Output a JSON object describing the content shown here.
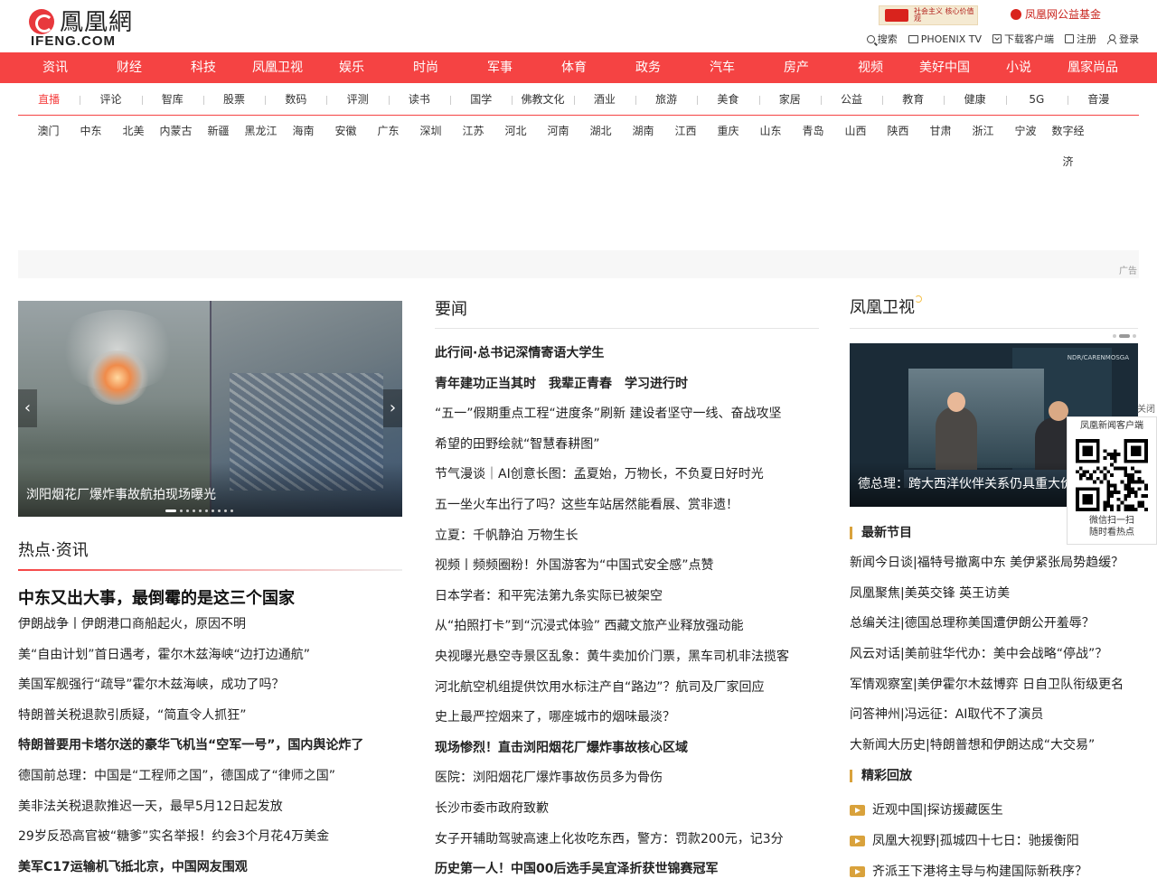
{
  "logo": {
    "cn": "鳳凰網",
    "en": "IFENG.COM"
  },
  "banners": {
    "b1": "社会主义 核心价值观",
    "b2": "凤凰网公益基金"
  },
  "tools": [
    {
      "icon": "search-icon",
      "label": "搜索"
    },
    {
      "icon": "tv-icon",
      "label": "PHOENIX TV"
    },
    {
      "icon": "download-icon",
      "label": "下载客户端"
    },
    {
      "icon": "register-icon",
      "label": "注册"
    },
    {
      "icon": "user-icon",
      "label": "登录"
    }
  ],
  "nav_primary": [
    "资讯",
    "财经",
    "科技",
    "凤凰卫视",
    "娱乐",
    "时尚",
    "军事",
    "体育",
    "政务",
    "汽车",
    "房产",
    "视频",
    "美好中国",
    "小说",
    "凰家尚品"
  ],
  "nav_secondary": [
    "直播",
    "评论",
    "智库",
    "股票",
    "数码",
    "评测",
    "读书",
    "国学",
    "佛教文化",
    "酒业",
    "旅游",
    "美食",
    "家居",
    "公益",
    "教育",
    "健康",
    "5G",
    "音漫"
  ],
  "nav_regions": [
    "澳门",
    "中东",
    "北美",
    "内蒙古",
    "新疆",
    "黑龙江",
    "海南",
    "安徽",
    "广东",
    "深圳",
    "江苏",
    "河北",
    "河南",
    "湖北",
    "湖南",
    "江西",
    "重庆",
    "山东",
    "青岛",
    "山西",
    "陕西",
    "甘肃",
    "浙江",
    "宁波",
    "数字经济"
  ],
  "ad_label": "广告",
  "slider": {
    "caption": "浏阳烟花厂爆炸事故航拍现场曝光",
    "prev": "‹",
    "next": "›"
  },
  "hot": {
    "title": "热点·资讯",
    "headline": "中东又出大事，最倒霉的是这三个国家",
    "items": [
      {
        "text": "伊朗战争丨伊朗港口商船起火，原因不明",
        "bold": false
      },
      {
        "text": "美“自由计划”首日遇考，霍尔木兹海峡“边打边通航”",
        "bold": false
      },
      {
        "text": "美国军舰强行“疏导”霍尔木兹海峡，成功了吗？",
        "bold": false
      },
      {
        "text": "特朗普关税退款引质疑，“简直令人抓狂”",
        "bold": false
      },
      {
        "text": "特朗普要用卡塔尔送的豪华飞机当“空军一号”，国内舆论炸了",
        "bold": true
      },
      {
        "text": "德国前总理：中国是“工程师之国”，德国成了“律师之国”",
        "bold": false
      },
      {
        "text": "美非法关税退款推迟一天，最早5月12日起发放",
        "bold": false
      },
      {
        "text": "29岁反恐高官被“糖爹”实名举报！约会3个月花4万美金",
        "bold": false
      },
      {
        "text": "美军C17运输机飞抵北京，中国网友围观",
        "bold": true
      }
    ]
  },
  "news": {
    "title": "要闻",
    "items": [
      {
        "text": "此行间·总书记深情寄语大学生",
        "bold": true
      },
      {
        "text": "青年建功正当其时　我辈正青春　学习进行时",
        "bold": true
      },
      {
        "text": "“五一”假期重点工程“进度条”刷新 建设者坚守一线、奋战攻坚",
        "bold": false
      },
      {
        "text": "希望的田野绘就“智慧春耕图”",
        "bold": false
      },
      {
        "text": "节气漫谈｜AI创意长图：孟夏始，万物长，不负夏日好时光",
        "bold": false
      },
      {
        "text": "五一坐火车出行了吗？这些车站居然能看展、赏非遗！",
        "bold": false
      },
      {
        "text": "立夏：千帆静泊 万物生长",
        "bold": false
      },
      {
        "text": "视频丨频频圈粉！外国游客为“中国式安全感”点赞",
        "bold": false
      },
      {
        "text": "日本学者：和平宪法第九条实际已被架空",
        "bold": false
      },
      {
        "text": "从“拍照打卡”到“沉浸式体验” 西藏文旅产业释放强动能",
        "bold": false
      },
      {
        "text": "央视曝光悬空寺景区乱象：黄牛卖加价门票，黑车司机非法揽客",
        "bold": false
      },
      {
        "text": "河北航空机组提供饮用水标注产自“路边”？航司及厂家回应",
        "bold": false
      },
      {
        "text": "史上最严控烟来了，哪座城市的烟味最淡？",
        "bold": false
      },
      {
        "text": "现场惨烈！直击浏阳烟花厂爆炸事故核心区域",
        "bold": true
      },
      {
        "text": "医院：浏阳烟花厂爆炸事故伤员多为骨伤",
        "bold": false
      },
      {
        "text": "长沙市委市政府致歉",
        "bold": false
      },
      {
        "text": "女子开辅助驾驶高速上化妆吃东西，警方：罚款200元，记3分",
        "bold": false
      },
      {
        "text": "历史第一人！中国00后选手吴宜泽折获世锦赛冠军",
        "bold": true
      }
    ]
  },
  "tv": {
    "title": "凤凰卫视",
    "image_caption": "德总理：跨大西洋伙伴关系仍具重大价值",
    "image_logo": "NDR/CARENMOSGA",
    "latest_title": "最新节目",
    "latest": [
      "新闻今日谈|福特号撤离中东 美伊紧张局势趋缓？",
      "凤凰聚焦|美英交锋 英王访美",
      "总编关注|德国总理称美国遭伊朗公开羞辱？",
      "风云对话|美前驻华代办：美中会战略“停战”？",
      "军情观察室|美伊霍尔木兹博弈 日自卫队衔级更名",
      "问答神州|冯远征：AI取代不了演员",
      "大新闻大历史|特朗普想和伊朗达成“大交易”"
    ],
    "replay_title": "精彩回放",
    "replay": [
      "近观中国|探访援藏医生",
      "凤凰大视野|孤城四十七日：驰援衡阳",
      "齐派王下港将主导与构建国际新秩序？"
    ]
  },
  "qr": {
    "close": "关闭",
    "title": "凤凰新闻客户端",
    "line1": "微信扫一扫",
    "line2": "随时看热点"
  }
}
